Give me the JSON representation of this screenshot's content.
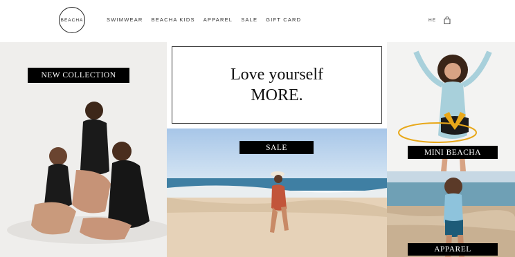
{
  "brand": {
    "logo_text": "BEACHA"
  },
  "nav": {
    "items": [
      {
        "label": "SWIMWEAR"
      },
      {
        "label": "BEACHA KIDS"
      },
      {
        "label": "APPAREL"
      },
      {
        "label": "SALE"
      },
      {
        "label": "GIFT CARD"
      }
    ]
  },
  "header": {
    "language": "HE",
    "cart_icon": "shopping-bag-icon"
  },
  "tiles": {
    "collection": {
      "label": "NEW COLLECTION"
    },
    "promo": {
      "line1": "Love yourself",
      "line2": "MORE."
    },
    "sale": {
      "label": "SALE"
    },
    "mini": {
      "label": "MINI  BEACHA"
    },
    "apparel": {
      "label": "APPAREL"
    }
  }
}
